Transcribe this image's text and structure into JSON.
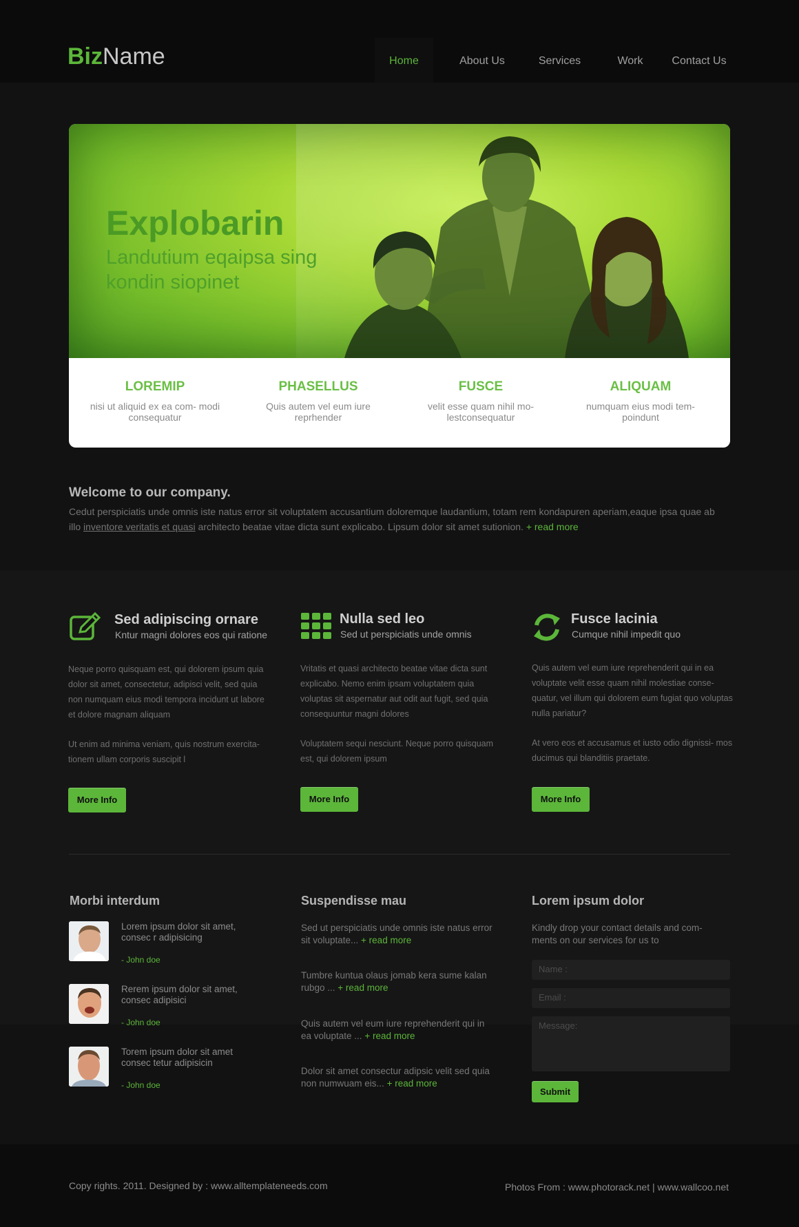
{
  "logo": {
    "part1": "Biz",
    "part2": "Name"
  },
  "nav": [
    "Home",
    "About Us",
    "Services",
    "Work",
    "Contact Us"
  ],
  "hero": {
    "title": "Explobarin",
    "subtitle": "Landutium eqaipsa sing kondin siopinet",
    "features": [
      {
        "title": "LOREMIP",
        "text": "nisi ut aliquid ex ea com- modi consequatur"
      },
      {
        "title": "PHASELLUS",
        "text": "Quis autem vel eum iure reprhender"
      },
      {
        "title": "FUSCE",
        "text": "velit esse quam nihil mo- lestconsequatur"
      },
      {
        "title": "ALIQUAM",
        "text": "numquam eius modi tem- poindunt"
      }
    ]
  },
  "welcome": {
    "title": "Welcome to our company.",
    "text_before": "Cedut perspiciatis unde omnis iste natus error sit voluptatem accusantium doloremque laudantium, totam rem kondapuren  aperiam,eaque ipsa quae ab illo ",
    "underlined": "inventore veritatis et quasi",
    "text_after": " architecto beatae vitae dicta sunt explicabo. Lipsum dolor sit amet sutionion. ",
    "read_more": "+ read more"
  },
  "columns": [
    {
      "icon": "edit-icon",
      "title": "Sed adipiscing ornare",
      "subtitle": "Kntur magni dolores eos qui ratione",
      "p1": "Neque porro quisquam est, qui dolorem ipsum quia dolor sit amet, consectetur, adipisci velit, sed quia non numquam eius modi tempora incidunt ut labore et dolore magnam aliquam",
      "p2": "Ut enim ad minima veniam, quis nostrum exercita- tionem ullam corporis suscipit l",
      "button": "More Info"
    },
    {
      "icon": "grid-icon",
      "title": "Nulla sed leo",
      "subtitle": "Sed ut perspiciatis unde omnis",
      "p1": "Vritatis et quasi architecto beatae vitae dicta sunt explicabo. Nemo enim ipsam voluptatem quia voluptas sit aspernatur aut odit aut fugit, sed quia consequuntur magni dolores",
      "p2": "Voluptatem sequi nesciunt. Neque porro quisquam est, qui dolorem ipsum",
      "button": "More Info"
    },
    {
      "icon": "refresh-icon",
      "title": "Fusce lacinia",
      "subtitle": "Cumque nihil impedit quo",
      "p1": "Quis autem vel eum iure reprehenderit qui in ea voluptate velit esse quam nihil molestiae conse- quatur, vel illum qui dolorem eum fugiat quo voluptas nulla pariatur?",
      "p2": " At vero eos et accusamus et iusto odio dignissi- mos ducimus qui blanditiis praetate.",
      "button": "More Info"
    }
  ],
  "testimonials": {
    "title": "Morbi interdum",
    "items": [
      {
        "text": "Lorem ipsum dolor sit amet, consec r adipisicing",
        "author": "- John doe"
      },
      {
        "text": "Rerem ipsum dolor sit amet, consec adipisici",
        "author": "- John doe"
      },
      {
        "text": "Torem ipsum dolor sit amet consec tetur adipisicin",
        "author": "- John doe"
      }
    ]
  },
  "suspendisse": {
    "title": "Suspendisse mau",
    "items": [
      {
        "text": "Sed ut perspiciatis unde omnis iste natus error sit voluptate... ",
        "link": "+ read more"
      },
      {
        "text": "Tumbre kuntua olaus jomab kera sume kalan rubgo ... ",
        "link": "+ read more"
      },
      {
        "text": "Quis autem vel eum iure reprehenderit qui in ea voluptate  ... ",
        "link": "+ read more"
      },
      {
        "text": "Dolor sit amet consectur adipsic velit sed quia non numwuam eis... ",
        "link": "+ read more"
      }
    ]
  },
  "contact": {
    "title": "Lorem ipsum dolor",
    "text": "Kindly drop your contact details and com- ments on our services for us to",
    "name_placeholder": "Name :",
    "email_placeholder": "Email :",
    "message_placeholder": "Message:",
    "submit": "Submit"
  },
  "footer": {
    "copyright": "Copy rights. 2011. Designed by : www.alltemplateneeds.com",
    "photos": "Photos From : www.photorack.net | www.wallcoo.net"
  },
  "colors": {
    "accent": "#5cb63a",
    "background": "#121212"
  }
}
